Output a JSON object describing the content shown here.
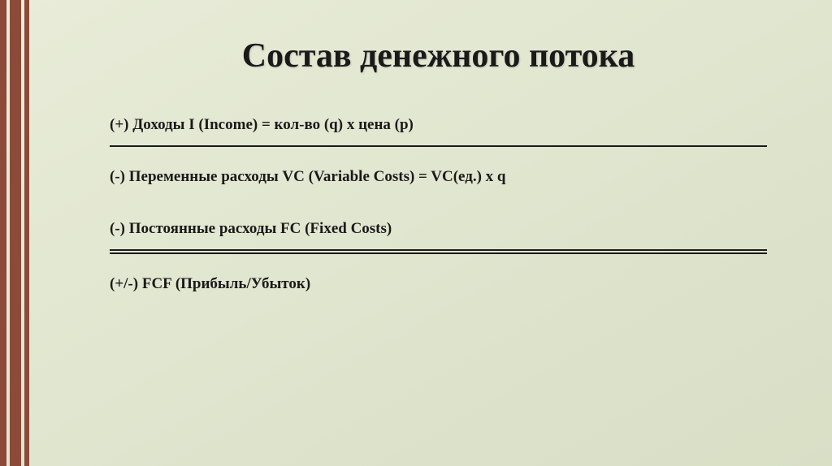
{
  "slide": {
    "title": "Состав денежного потока",
    "lines": {
      "income": "(+) Доходы I (Income) = кол-во (q) x цена (p)",
      "variable_costs": "(-) Переменные расходы VC (Variable Costs) = VC(ед.) х q",
      "fixed_costs": "(-) Постоянные расходы FC (Fixed Costs)",
      "fcf": "(+/-) FCF (Прибыль/Убыток)"
    }
  }
}
